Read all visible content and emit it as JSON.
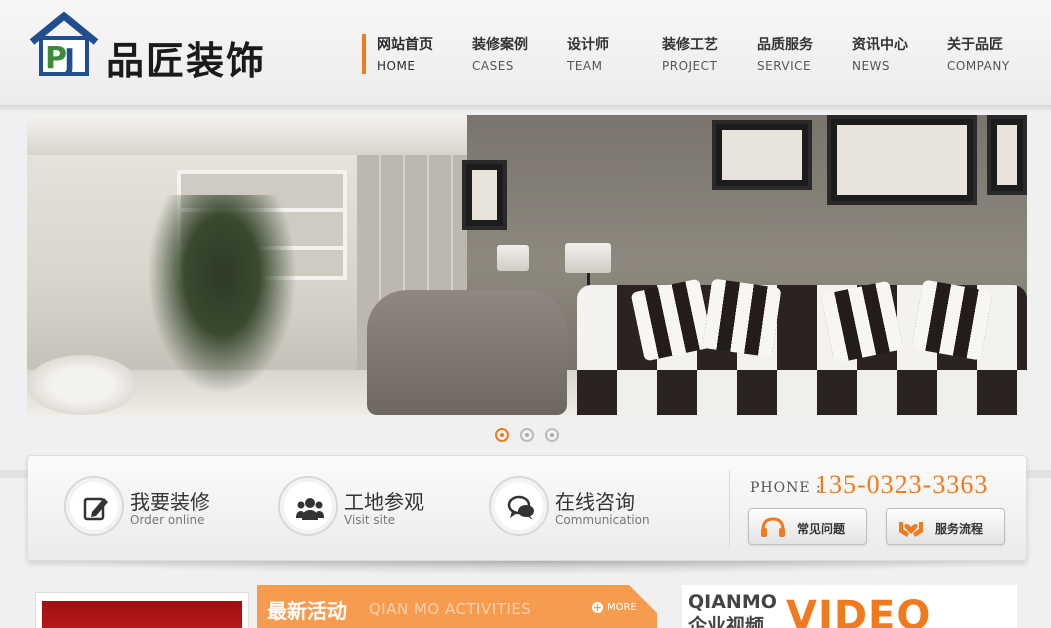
{
  "brand": {
    "name": "品匠装饰",
    "mark": "PJ"
  },
  "nav": {
    "items": [
      {
        "cn": "网站首页",
        "en": "HOME"
      },
      {
        "cn": "装修案例",
        "en": "CASES"
      },
      {
        "cn": "设计师",
        "en": "TEAM"
      },
      {
        "cn": "装修工艺",
        "en": "PROJECT"
      },
      {
        "cn": "品质服务",
        "en": "SERVICE"
      },
      {
        "cn": "资讯中心",
        "en": "NEWS"
      },
      {
        "cn": "关于品匠",
        "en": "COMPANY"
      }
    ],
    "active_index": 0
  },
  "banner": {
    "slide_count": 3,
    "active_slide": 0
  },
  "services": {
    "items": [
      {
        "title": "我要装修",
        "subtitle": "Order online",
        "icon": "edit-icon"
      },
      {
        "title": "工地参观",
        "subtitle": "Visit site",
        "icon": "group-icon"
      },
      {
        "title": "在线咨询",
        "subtitle": "Communication",
        "icon": "chat-icon"
      }
    ],
    "phone_label": "PHONE :",
    "phone_number": "135-0323-3363",
    "buttons": [
      {
        "label": "常见问题",
        "icon": "headset-icon"
      },
      {
        "label": "服务流程",
        "icon": "hands-heart-icon"
      }
    ]
  },
  "activity": {
    "title": "最新活动",
    "subtitle": "QIAN MO ACTIVITIES",
    "more": "MORE"
  },
  "video": {
    "brand_en": "QIANMO",
    "title_cn": "企业视频",
    "title_en": "VIDEO"
  },
  "colors": {
    "accent": "#f07a1d",
    "activity_bg": "#f79b4e",
    "logo_blue": "#1f4f8f",
    "logo_green": "#3f8a3a"
  }
}
